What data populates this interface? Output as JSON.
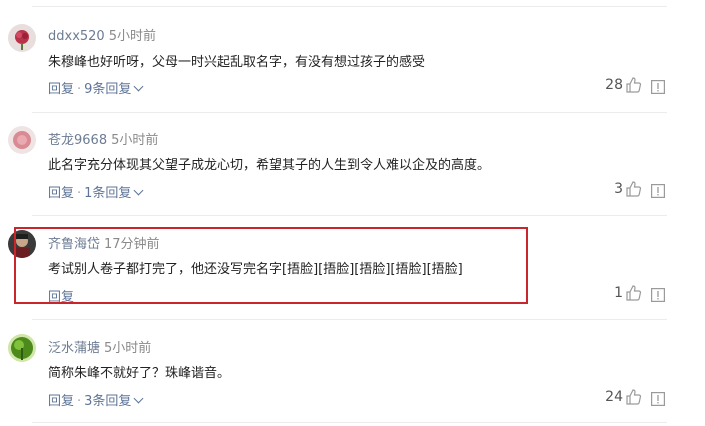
{
  "comments": [
    {
      "user": "ddxx520",
      "time": "5小时前",
      "text": "朱穆峰也好听呀，父母一时兴起乱取名字，有没有想过孩子的感受",
      "reply_label": "回复",
      "sep": "·",
      "replies_label": "9条回复",
      "likes": "28"
    },
    {
      "user": "苍龙9668",
      "time": "5小时前",
      "text": "此名字充分体现其父望子成龙心切，希望其子的人生到令人难以企及的高度。",
      "reply_label": "回复",
      "sep": "·",
      "replies_label": "1条回复",
      "likes": "3"
    },
    {
      "user": "齐鲁海岱",
      "time": "17分钟前",
      "text": "考试别人卷子都打完了，他还没写完名字[捂脸][捂脸][捂脸][捂脸][捂脸]",
      "reply_label": "回复",
      "likes": "1"
    },
    {
      "user": "泛水蒲塘",
      "time": "5小时前",
      "text": "简称朱峰不就好了？珠峰谐音。",
      "reply_label": "回复",
      "sep": "·",
      "replies_label": "3条回复",
      "likes": "24"
    }
  ],
  "colors": {
    "username": "#6d7c93",
    "link": "#5e7496",
    "highlight_border": "#c8252c"
  }
}
